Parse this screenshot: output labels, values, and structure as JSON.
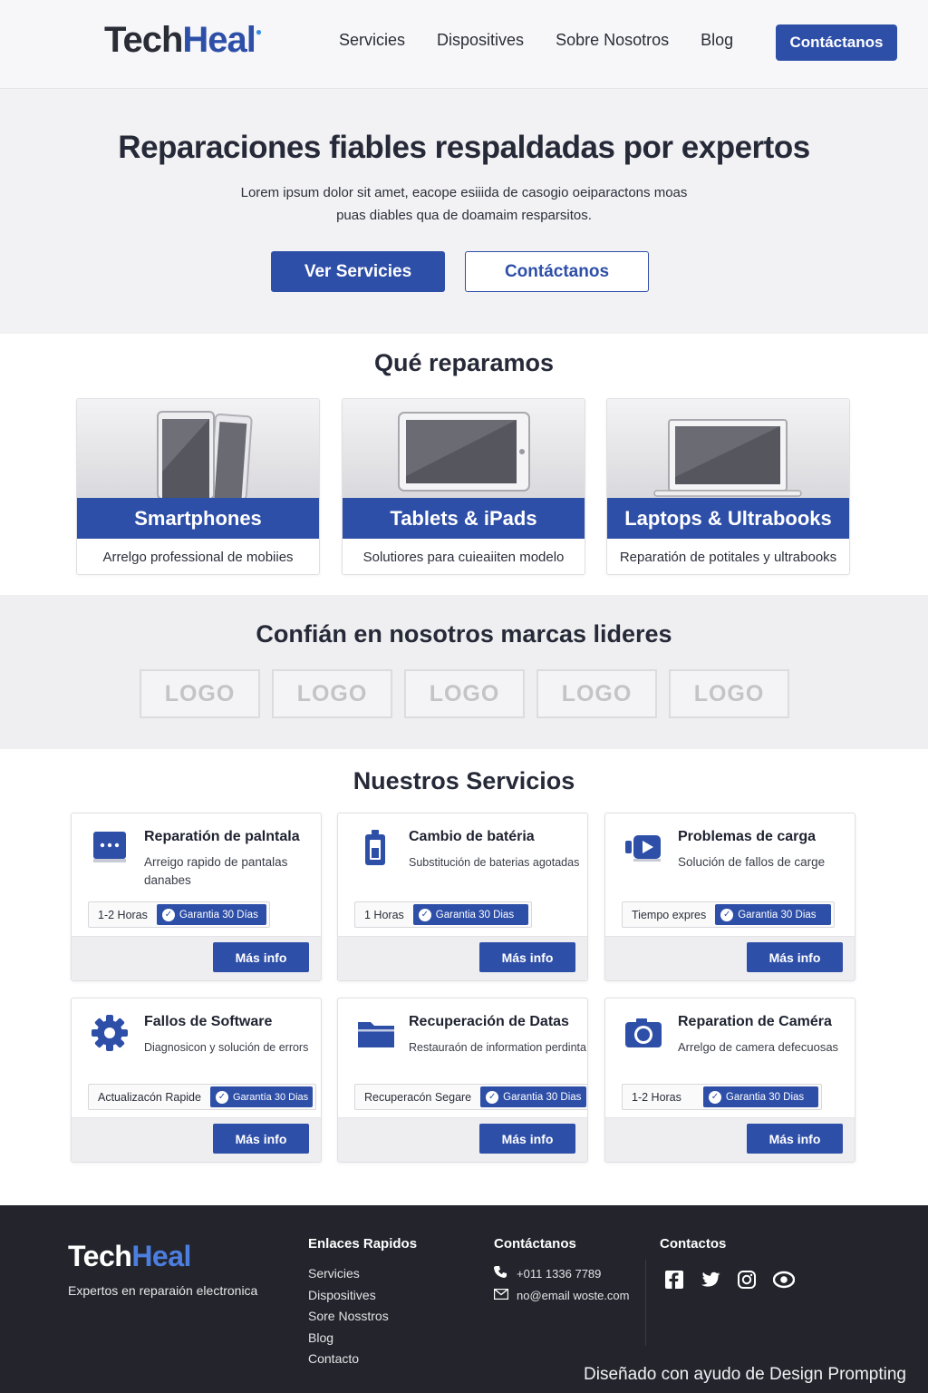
{
  "header": {
    "logo_tech": "Tech",
    "logo_heal": "Heal",
    "nav": [
      "Servicies",
      "Dispositives",
      "Sobre Nosotros",
      "Blog"
    ],
    "cta": "Contáctanos"
  },
  "hero": {
    "title": "Reparaciones fiables respaldadas por expertos",
    "text": "Lorem ipsum dolor sit amet, eacope esiiida de casogio oeiparactons moas puas diables qua de doamaim resparsitos.",
    "primary_btn": "Ver Servicies",
    "secondary_btn": "Contáctanos"
  },
  "repair": {
    "title": "Qué reparamos",
    "cards": [
      {
        "icon": "smartphones-image",
        "title": "Smartphones",
        "desc": "Arrelgo professional de mobiies"
      },
      {
        "icon": "tablet-image",
        "title": "Tablets & iPads",
        "desc": "Solutiores para cuieaiiten modelo"
      },
      {
        "icon": "laptop-image",
        "title": "Laptops & Ultrabooks",
        "desc": "Reparatión de potitales y ultrabooks"
      }
    ]
  },
  "brands": {
    "title": "Confián en nosotros marcas lideres",
    "logos": [
      "LOGO",
      "LOGO",
      "LOGO",
      "LOGO",
      "LOGO"
    ]
  },
  "services": {
    "title": "Nuestros Servicios",
    "items": [
      {
        "icon": "screen-icon",
        "title": "Reparatión de palntala",
        "desc": "Arreigo rapido de pantalas danabes",
        "time": "1-2 Horas",
        "badge": "Garantia 30 Días",
        "btn": "Más info"
      },
      {
        "icon": "battery-icon",
        "title": "Cambio de batéria",
        "desc": "Substitución de baterias agotadas",
        "time": "1 Horas",
        "badge": "Garantia 30 Dias",
        "btn": "Más info"
      },
      {
        "icon": "charging-icon",
        "title": "Problemas de carga",
        "desc": "Solución de fallos de carge",
        "time": "Tiempo expres",
        "badge": "Garantia 30 Dias",
        "btn": "Más info"
      },
      {
        "icon": "gear-icon",
        "title": "Fallos de Software",
        "desc": "Diagnosicon y solución de errors",
        "time": "Actualizacón Rapide",
        "badge": "Garantía 30 Dias",
        "btn": "Más info"
      },
      {
        "icon": "folder-icon",
        "title": "Recuperación de Datas",
        "desc": "Restauraón de information perdinta",
        "time": "Recuperacón Segare",
        "badge": "Garantia 30 Dias",
        "btn": "Más info"
      },
      {
        "icon": "camera-icon",
        "title": "Reparation de Caméra",
        "desc": "Arrelgo de camera defecuosas",
        "time": "1-2 Horas",
        "badge": "Garantia 30 Dias",
        "btn": "Más info"
      }
    ]
  },
  "footer": {
    "logo_tech": "Tech",
    "logo_heal": "Heal",
    "tagline": "Expertos en reparaión electronica",
    "links_title": "Enlaces Rapidos",
    "links": [
      "Servicies",
      "Dispositives",
      "Sore Nosstros",
      "Blog",
      "Contacto"
    ],
    "contact_title": "Contáctanos",
    "phone": "+011 1336 7789",
    "email": "no@email woste.com",
    "social_title": "Contactos",
    "social": [
      "facebook-icon",
      "twitter-icon",
      "instagram-icon",
      "eye-icon"
    ],
    "credit": "Diseñado con ayudo de Design Prompting"
  },
  "colors": {
    "accent": "#2e4fa8",
    "footer_bg": "#24252c",
    "text": "#1e2230"
  }
}
